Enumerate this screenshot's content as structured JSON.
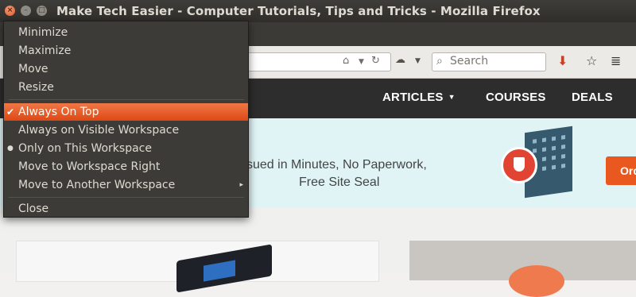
{
  "window": {
    "title": "Make Tech Easier - Computer Tutorials, Tips and Tricks - Mozilla Firefox",
    "close_glyph": "×",
    "minimize_glyph": "–",
    "maximize_glyph": "□"
  },
  "navbar": {
    "search_placeholder": "Search"
  },
  "site_nav": {
    "items": [
      {
        "label": "ARTICLES",
        "has_dropdown": true
      },
      {
        "label": "COURSES"
      },
      {
        "label": "DEALS"
      }
    ]
  },
  "banner": {
    "line1": "sued in Minutes, No Paperwork,",
    "line2": "Free Site Seal",
    "button_label": "Ord"
  },
  "menu": {
    "items": [
      {
        "label": "Minimize"
      },
      {
        "label": "Maximize"
      },
      {
        "label": "Move"
      },
      {
        "label": "Resize"
      },
      {
        "label": "Always On Top",
        "checked": true,
        "highlighted": true,
        "mark": "✔"
      },
      {
        "label": "Always on Visible Workspace"
      },
      {
        "label": "Only on This Workspace",
        "radio_selected": true,
        "mark": "●"
      },
      {
        "label": "Move to Workspace Right"
      },
      {
        "label": "Move to Another Workspace",
        "submenu": true,
        "arrow": "▸"
      },
      {
        "label": "Close"
      }
    ]
  },
  "colors": {
    "menu_bg": "#3c3b37",
    "menu_highlight": "#dd4814",
    "titlebar_bg": "#3b3a36",
    "site_header_bg": "#2d2d2d",
    "banner_bg": "#e0f4f6",
    "order_button": "#e8581f"
  }
}
